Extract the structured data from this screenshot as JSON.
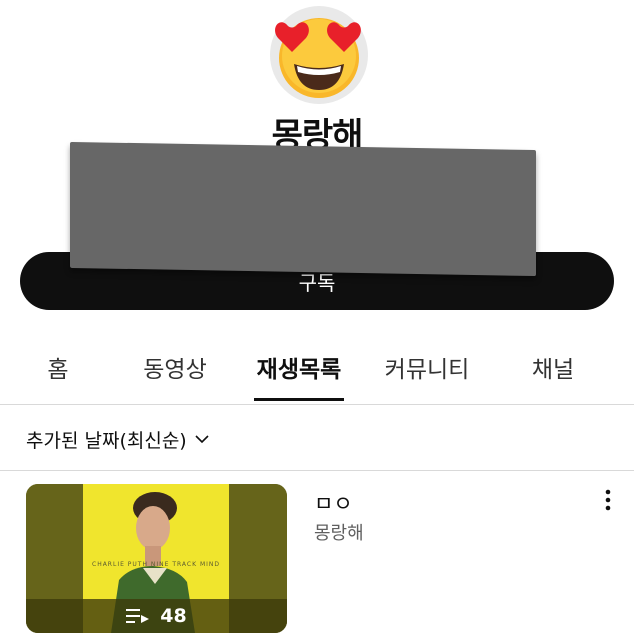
{
  "channel": {
    "name": "몽랑해",
    "avatar_icon": "heart-eyes-emoji-icon"
  },
  "subscribe": {
    "label": "구독"
  },
  "tabs": [
    {
      "label": "홈",
      "active": false
    },
    {
      "label": "동영상",
      "active": false
    },
    {
      "label": "재생목록",
      "active": true
    },
    {
      "label": "커뮤니티",
      "active": false
    },
    {
      "label": "채널",
      "active": false
    }
  ],
  "sort": {
    "label": "추가된 날짜(최신순)",
    "icon": "chevron-down-icon"
  },
  "playlist": {
    "title": "ㅁㅇ",
    "owner": "몽랑해",
    "video_count": "48",
    "album_text": "CHARLIE PUTH NINE TRACK MIND",
    "count_icon": "playlist-play-icon",
    "menu_icon": "more-vert-icon"
  },
  "colors": {
    "subscribe_bg": "#0f0f0f",
    "album_yellow": "#f0e52d",
    "thumb_side": "#66641a"
  }
}
